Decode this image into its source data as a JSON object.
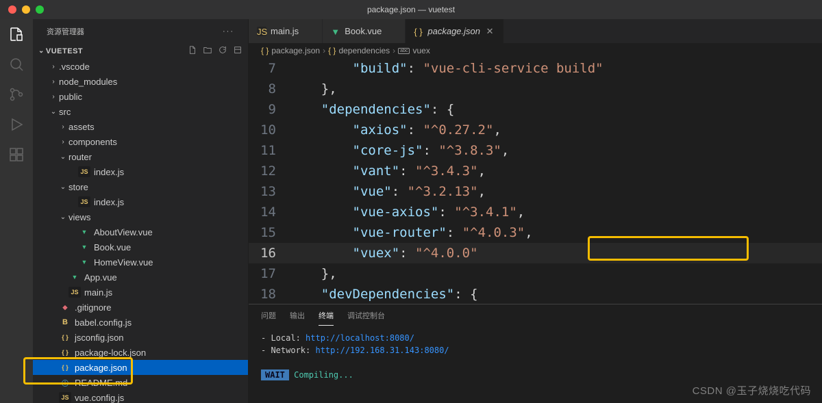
{
  "window": {
    "title": "package.json — vuetest"
  },
  "sidebar": {
    "header": "资源管理器",
    "project": "VUETEST",
    "tree": [
      {
        "name": ".vscode",
        "type": "folder",
        "depth": 1,
        "expanded": false
      },
      {
        "name": "node_modules",
        "type": "folder",
        "depth": 1,
        "expanded": false
      },
      {
        "name": "public",
        "type": "folder",
        "depth": 1,
        "expanded": false
      },
      {
        "name": "src",
        "type": "folder",
        "depth": 1,
        "expanded": true
      },
      {
        "name": "assets",
        "type": "folder",
        "depth": 2,
        "expanded": false
      },
      {
        "name": "components",
        "type": "folder",
        "depth": 2,
        "expanded": false
      },
      {
        "name": "router",
        "type": "folder",
        "depth": 2,
        "expanded": true
      },
      {
        "name": "index.js",
        "type": "js",
        "depth": 3
      },
      {
        "name": "store",
        "type": "folder",
        "depth": 2,
        "expanded": true
      },
      {
        "name": "index.js",
        "type": "js",
        "depth": 3
      },
      {
        "name": "views",
        "type": "folder",
        "depth": 2,
        "expanded": true
      },
      {
        "name": "AboutView.vue",
        "type": "vue",
        "depth": 3
      },
      {
        "name": "Book.vue",
        "type": "vue",
        "depth": 3
      },
      {
        "name": "HomeView.vue",
        "type": "vue",
        "depth": 3
      },
      {
        "name": "App.vue",
        "type": "vue",
        "depth": 2
      },
      {
        "name": "main.js",
        "type": "js",
        "depth": 2
      },
      {
        "name": ".gitignore",
        "type": "git",
        "depth": 1
      },
      {
        "name": "babel.config.js",
        "type": "babel",
        "depth": 1
      },
      {
        "name": "jsconfig.json",
        "type": "json",
        "depth": 1
      },
      {
        "name": "package-lock.json",
        "type": "json",
        "depth": 1
      },
      {
        "name": "package.json",
        "type": "json",
        "depth": 1,
        "selected": true
      },
      {
        "name": "README.md",
        "type": "md",
        "depth": 1
      },
      {
        "name": "vue.config.js",
        "type": "js",
        "depth": 1
      }
    ]
  },
  "tabs": [
    {
      "label": "main.js",
      "icon": "js",
      "active": false
    },
    {
      "label": "Book.vue",
      "icon": "vue",
      "active": false
    },
    {
      "label": "package.json",
      "icon": "json",
      "active": true,
      "italic": true
    }
  ],
  "breadcrumbs": {
    "file": "package.json",
    "section": "dependencies",
    "key": "vuex"
  },
  "code": {
    "lines": [
      {
        "n": 7,
        "indent": 2,
        "k": "\"build\"",
        "v": "\"vue-cli-service build\""
      },
      {
        "n": 8,
        "indent": 1,
        "raw": "},"
      },
      {
        "n": 9,
        "indent": 1,
        "k": "\"dependencies\"",
        "v": "{"
      },
      {
        "n": 10,
        "indent": 2,
        "k": "\"axios\"",
        "v": "\"^0.27.2\"",
        "comma": true
      },
      {
        "n": 11,
        "indent": 2,
        "k": "\"core-js\"",
        "v": "\"^3.8.3\"",
        "comma": true
      },
      {
        "n": 12,
        "indent": 2,
        "k": "\"vant\"",
        "v": "\"^3.4.3\"",
        "comma": true
      },
      {
        "n": 13,
        "indent": 2,
        "k": "\"vue\"",
        "v": "\"^3.2.13\"",
        "comma": true,
        "highlight": true
      },
      {
        "n": 14,
        "indent": 2,
        "k": "\"vue-axios\"",
        "v": "\"^3.4.1\"",
        "comma": true
      },
      {
        "n": 15,
        "indent": 2,
        "k": "\"vue-router\"",
        "v": "\"^4.0.3\"",
        "comma": true
      },
      {
        "n": 16,
        "indent": 2,
        "k": "\"vuex\"",
        "v": "\"^4.0.0\"",
        "current": true
      },
      {
        "n": 17,
        "indent": 1,
        "raw": "},"
      },
      {
        "n": 18,
        "indent": 1,
        "k": "\"devDependencies\"",
        "v": "{"
      }
    ]
  },
  "panel": {
    "tabs": {
      "problems": "问题",
      "output": "输出",
      "terminal": "终端",
      "debug": "调试控制台"
    },
    "terminal": {
      "local_label": "- Local:   ",
      "local_url_prefix": "http://localhost:",
      "local_port": "8080",
      "local_url_suffix": "/",
      "network_label": "- Network: ",
      "network_url_prefix": "http://192.168.31.143:",
      "network_port": "8080",
      "network_url_suffix": "/",
      "wait": "WAIT",
      "compiling": " Compiling..."
    }
  },
  "watermark": "CSDN @玉子烧烧吃代码"
}
